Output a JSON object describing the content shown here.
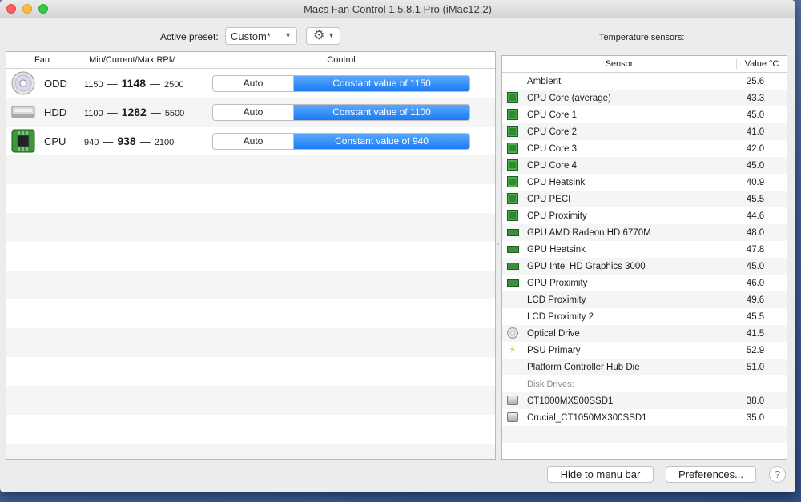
{
  "window": {
    "title": "Macs Fan Control 1.5.8.1 Pro (iMac12,2)"
  },
  "toolbar": {
    "preset_label": "Active preset:",
    "preset_value": "Custom*",
    "gear_icon": "gear-icon"
  },
  "fans": {
    "headers": {
      "fan": "Fan",
      "rpm": "Min/Current/Max RPM",
      "control": "Control"
    },
    "rows": [
      {
        "name": "ODD",
        "icon": "optical-drive-icon",
        "min": "1150",
        "current": "1148",
        "max": "2500",
        "auto_label": "Auto",
        "control_label": "Constant value of 1150"
      },
      {
        "name": "HDD",
        "icon": "hard-drive-icon",
        "min": "1100",
        "current": "1282",
        "max": "5500",
        "auto_label": "Auto",
        "control_label": "Constant value of 1100"
      },
      {
        "name": "CPU",
        "icon": "cpu-chip-icon",
        "min": "940",
        "current": "938",
        "max": "2100",
        "auto_label": "Auto",
        "control_label": "Constant value of 940"
      }
    ],
    "dash": "—"
  },
  "sensors": {
    "title": "Temperature sensors:",
    "headers": {
      "sensor": "Sensor",
      "value": "Value °C"
    },
    "rows": [
      {
        "name": "Ambient",
        "value": "25.6",
        "icon": "none"
      },
      {
        "name": "CPU Core (average)",
        "value": "43.3",
        "icon": "chip"
      },
      {
        "name": "CPU Core 1",
        "value": "45.0",
        "icon": "chip"
      },
      {
        "name": "CPU Core 2",
        "value": "41.0",
        "icon": "chip"
      },
      {
        "name": "CPU Core 3",
        "value": "42.0",
        "icon": "chip"
      },
      {
        "name": "CPU Core 4",
        "value": "45.0",
        "icon": "chip"
      },
      {
        "name": "CPU Heatsink",
        "value": "40.9",
        "icon": "chip"
      },
      {
        "name": "CPU PECI",
        "value": "45.5",
        "icon": "chip"
      },
      {
        "name": "CPU Proximity",
        "value": "44.6",
        "icon": "chip"
      },
      {
        "name": "GPU AMD Radeon HD 6770M",
        "value": "48.0",
        "icon": "gpu"
      },
      {
        "name": "GPU Heatsink",
        "value": "47.8",
        "icon": "gpu"
      },
      {
        "name": "GPU Intel HD Graphics 3000",
        "value": "45.0",
        "icon": "gpu"
      },
      {
        "name": "GPU Proximity",
        "value": "46.0",
        "icon": "gpu"
      },
      {
        "name": "LCD Proximity",
        "value": "49.6",
        "icon": "none"
      },
      {
        "name": "LCD Proximity 2",
        "value": "45.5",
        "icon": "none"
      },
      {
        "name": "Optical Drive",
        "value": "41.5",
        "icon": "disc"
      },
      {
        "name": "PSU Primary",
        "value": "52.9",
        "icon": "bolt"
      },
      {
        "name": "Platform Controller Hub Die",
        "value": "51.0",
        "icon": "none"
      }
    ],
    "disk_section": "Disk Drives:",
    "disks": [
      {
        "name": "CT1000MX500SSD1",
        "value": "38.0",
        "icon": "drive"
      },
      {
        "name": "Crucial_CT1050MX300SSD1",
        "value": "35.0",
        "icon": "drive"
      }
    ]
  },
  "footer": {
    "hide_label": "Hide to menu bar",
    "prefs_label": "Preferences...",
    "help_label": "?"
  },
  "colors": {
    "accent": "#1b7bf2",
    "chip": "#2f8a2f"
  }
}
